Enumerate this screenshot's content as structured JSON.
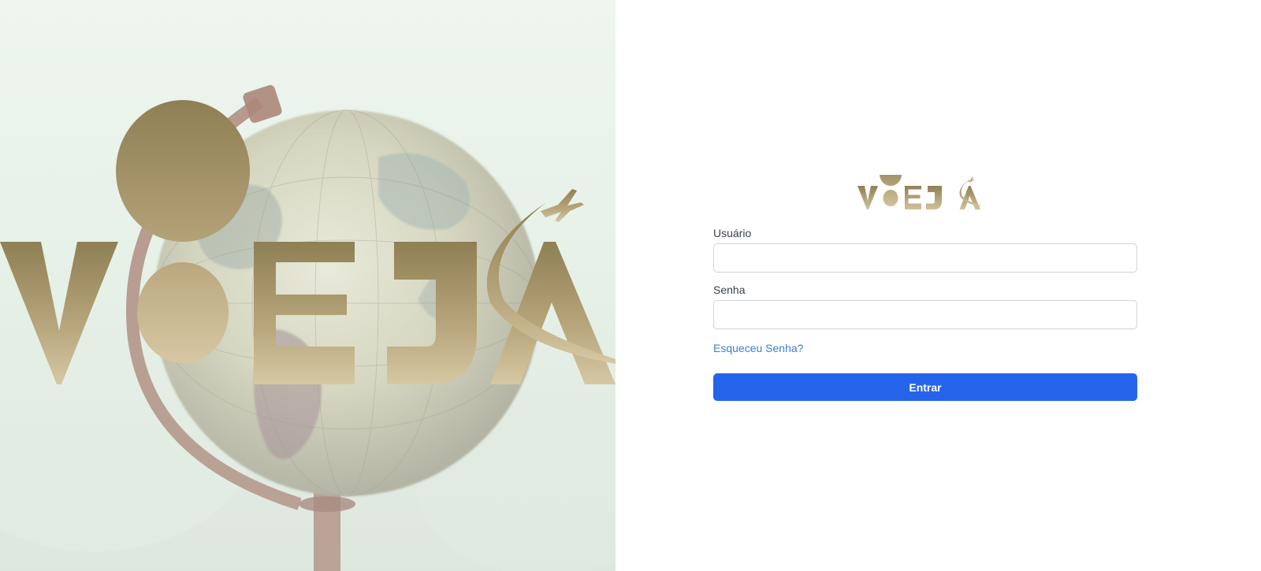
{
  "brand": {
    "name": "VOEJÁ",
    "gold_color": "#b8a578"
  },
  "login": {
    "username_label": "Usuário",
    "username_value": "",
    "password_label": "Senha",
    "password_value": "",
    "forgot_password": "Esqueceu Senha?",
    "submit_label": "Entrar",
    "submit_color": "#2563eb",
    "link_color": "#3b7fd4"
  },
  "hero": {
    "image_subject": "globe",
    "logo_name": "VOEJÁ"
  }
}
